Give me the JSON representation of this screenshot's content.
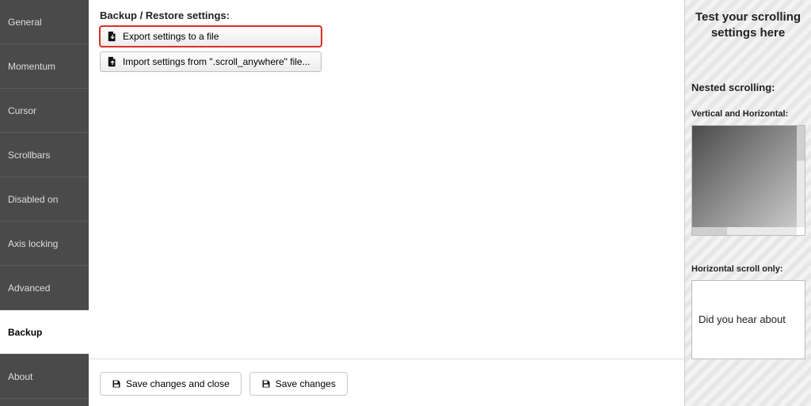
{
  "sidebar": {
    "items": [
      {
        "label": "General"
      },
      {
        "label": "Momentum"
      },
      {
        "label": "Cursor"
      },
      {
        "label": "Scrollbars"
      },
      {
        "label": "Disabled on"
      },
      {
        "label": "Axis locking"
      },
      {
        "label": "Advanced"
      },
      {
        "label": "Backup"
      },
      {
        "label": "About"
      }
    ],
    "active_index": 7
  },
  "backup_page": {
    "title": "Backup / Restore settings:",
    "export_button": "Export settings to a file",
    "import_button": "Import settings from \".scroll_anywhere\" file..."
  },
  "footer": {
    "save_close": "Save changes and close",
    "save": "Save changes"
  },
  "testpanel": {
    "title": "Test your scrolling settings here",
    "nested_heading": "Nested scrolling:",
    "nested_label": "Vertical and Horizontal:",
    "hscroll_label": "Horizontal scroll only:",
    "hscroll_text": "Did you hear about"
  }
}
